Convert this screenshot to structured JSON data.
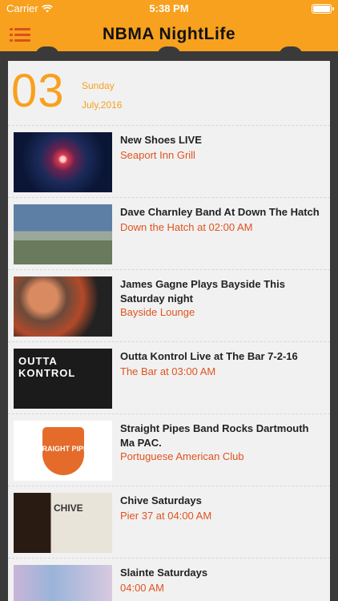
{
  "status_bar": {
    "carrier": "Carrier",
    "time": "5:38 PM",
    "battery_level": 1.0
  },
  "navbar": {
    "title": "NBMA NightLife",
    "menu_icon": "menu-icon"
  },
  "date_header": {
    "day": "03",
    "weekday": "Sunday",
    "month_year": "July,2016"
  },
  "events": [
    {
      "title": "New Shoes LIVE",
      "venue": "Seaport Inn Grill",
      "image": "fireworks"
    },
    {
      "title": "Dave Charnley Band At Down The Hatch",
      "venue": "Down the Hatch at 02:00 AM",
      "image": "band-outdoor"
    },
    {
      "title": "James Gagne Plays Bayside This Saturday night",
      "venue": "Bayside Lounge",
      "image": "singer-guitar"
    },
    {
      "title": "Outta Kontrol Live at The Bar 7-2-16",
      "venue": "The Bar at 03:00 AM",
      "image": "band-poster"
    },
    {
      "title": "Straight Pipes Band Rocks Dartmouth Ma PAC.",
      "venue": "Portuguese American Club",
      "image": "straight-pipes-logo"
    },
    {
      "title": "Chive Saturdays",
      "venue": "Pier 37 at 04:00 AM",
      "image": "chive-poster"
    },
    {
      "title": "Slainte Saturdays",
      "venue": " 04:00 AM",
      "image": "slainte-poster"
    }
  ]
}
